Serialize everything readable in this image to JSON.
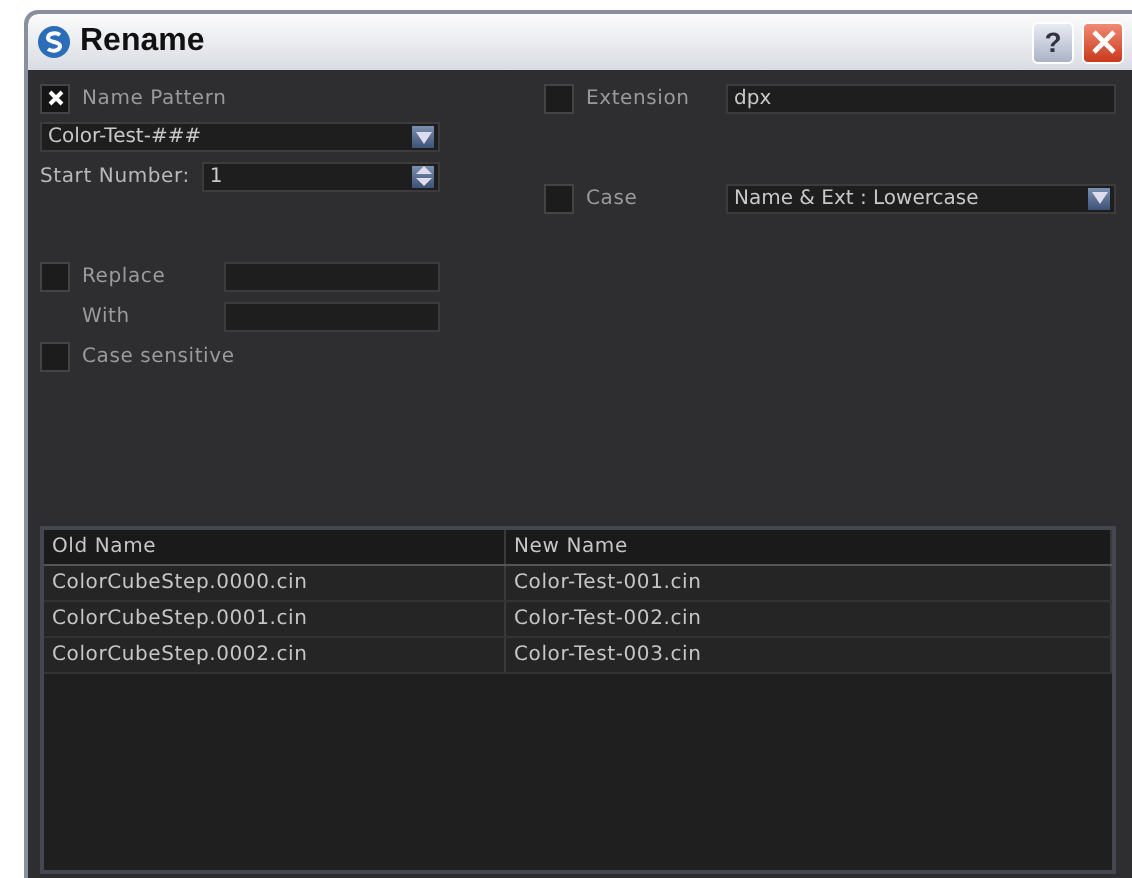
{
  "window": {
    "title": "Rename",
    "help": "?"
  },
  "name_pattern": {
    "label": "Name Pattern",
    "checked": true,
    "value": "Color-Test-###"
  },
  "start_number": {
    "label": "Start Number:",
    "value": "1"
  },
  "replace": {
    "label": "Replace",
    "checked": false
  },
  "with": {
    "label": "With"
  },
  "case_sensitive": {
    "label": "Case sensitive",
    "checked": false
  },
  "extension": {
    "label": "Extension",
    "checked": false,
    "value": "dpx"
  },
  "case": {
    "label": "Case",
    "checked": false,
    "value": "Name & Ext : Lowercase"
  },
  "table": {
    "columns": [
      "Old Name",
      "New Name"
    ],
    "rows": [
      [
        "ColorCubeStep.0000.cin",
        "Color-Test-001.cin"
      ],
      [
        "ColorCubeStep.0001.cin",
        "Color-Test-002.cin"
      ],
      [
        "ColorCubeStep.0002.cin",
        "Color-Test-003.cin"
      ]
    ]
  }
}
